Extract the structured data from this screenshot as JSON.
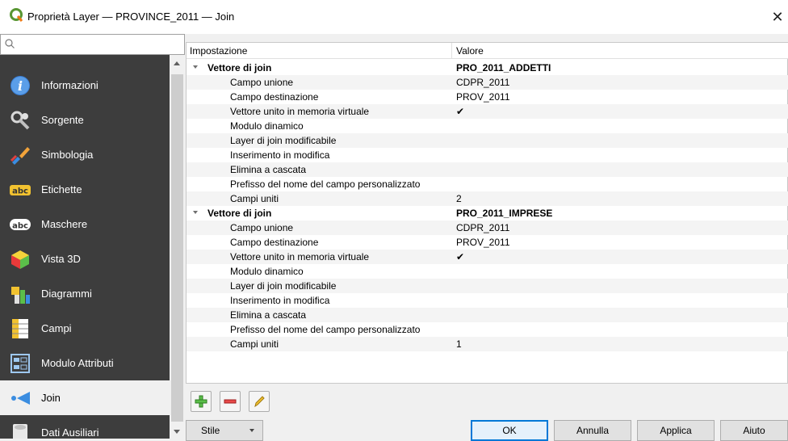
{
  "window": {
    "title": "Proprietà Layer — PROVINCE_2011 — Join",
    "close_glyph": "✕"
  },
  "sidebar": {
    "search_placeholder": "",
    "items": [
      {
        "label": "Informazioni",
        "icon": "info-icon"
      },
      {
        "label": "Sorgente",
        "icon": "source-wrench-icon"
      },
      {
        "label": "Simbologia",
        "icon": "paintbrush-icon"
      },
      {
        "label": "Etichette",
        "icon": "labels-abc-icon"
      },
      {
        "label": "Maschere",
        "icon": "masks-abc-icon"
      },
      {
        "label": "Vista 3D",
        "icon": "cube-3d-icon"
      },
      {
        "label": "Diagrammi",
        "icon": "diagram-icon"
      },
      {
        "label": "Campi",
        "icon": "fields-table-icon"
      },
      {
        "label": "Modulo Attributi",
        "icon": "attributes-form-icon"
      },
      {
        "label": "Join",
        "icon": "join-icon",
        "active": true
      },
      {
        "label": "Dati Ausiliari",
        "icon": "auxiliary-data-icon"
      }
    ]
  },
  "tree": {
    "col_setting": "Impostazione",
    "col_value": "Valore",
    "groups": [
      {
        "label": "Vettore di join",
        "value": "PRO_2011_ADDETTI",
        "rows": [
          {
            "k": "Campo unione",
            "v": "CDPR_2011"
          },
          {
            "k": "Campo destinazione",
            "v": "PROV_2011"
          },
          {
            "k": "Vettore unito in memoria virtuale",
            "v": "✔"
          },
          {
            "k": "Modulo dinamico",
            "v": ""
          },
          {
            "k": "Layer di join modificabile",
            "v": ""
          },
          {
            "k": "Inserimento in modifica",
            "v": ""
          },
          {
            "k": "Elimina a cascata",
            "v": ""
          },
          {
            "k": "Prefisso del nome del campo personalizzato",
            "v": ""
          },
          {
            "k": "Campi uniti",
            "v": "2"
          }
        ]
      },
      {
        "label": "Vettore di join",
        "value": "PRO_2011_IMPRESE",
        "rows": [
          {
            "k": "Campo unione",
            "v": "CDPR_2011"
          },
          {
            "k": "Campo destinazione",
            "v": "PROV_2011"
          },
          {
            "k": "Vettore unito in memoria virtuale",
            "v": "✔"
          },
          {
            "k": "Modulo dinamico",
            "v": ""
          },
          {
            "k": "Layer di join modificabile",
            "v": ""
          },
          {
            "k": "Inserimento in modifica",
            "v": ""
          },
          {
            "k": "Elimina a cascata",
            "v": ""
          },
          {
            "k": "Prefisso del nome del campo personalizzato",
            "v": ""
          },
          {
            "k": "Campi uniti",
            "v": "1"
          }
        ]
      }
    ]
  },
  "buttons": {
    "style": "Stile",
    "ok": "OK",
    "cancel": "Annulla",
    "apply": "Applica",
    "help": "Aiuto"
  },
  "colors": {
    "sidebar_bg": "#3d3d3d",
    "qgis_green": "#589632",
    "accent": "#0078d7"
  }
}
